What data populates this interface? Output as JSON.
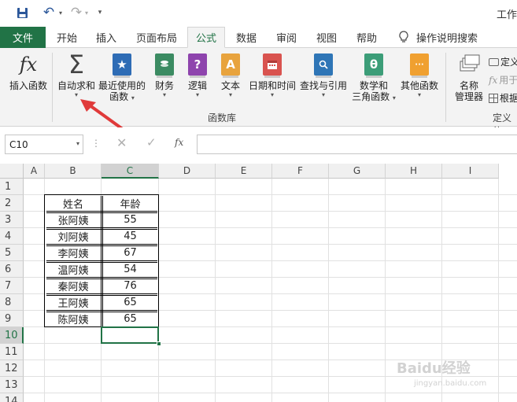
{
  "titlebar": {
    "title": "工作",
    "customize_symbol": "▾",
    "undo_symbol": "↶",
    "redo_symbol": "↷"
  },
  "tabs": [
    {
      "label": "文件"
    },
    {
      "label": "开始"
    },
    {
      "label": "插入"
    },
    {
      "label": "页面布局"
    },
    {
      "label": "公式",
      "active": true
    },
    {
      "label": "数据"
    },
    {
      "label": "审阅"
    },
    {
      "label": "视图"
    },
    {
      "label": "帮助"
    }
  ],
  "tell_me": "操作说明搜索",
  "ribbon": {
    "insert_function": "插入函数",
    "insert_function_symbol": "fx",
    "autosum": "自动求和",
    "autosum_symbol": "Σ",
    "recent_line1": "最近使用的",
    "recent_line2": "函数",
    "financial": "财务",
    "logical": "逻辑",
    "logical_symbol": "?",
    "text": "文本",
    "text_symbol": "A",
    "datetime": "日期和时间",
    "lookup": "查找与引用",
    "math_line1": "数学和",
    "math_line2": "三角函数",
    "math_symbol": "θ",
    "more": "其他函数",
    "more_symbol": "···",
    "group_label": "函数库",
    "name_manager_line1": "名称",
    "name_manager_line2": "管理器",
    "define_name": "定义",
    "use_in_formula": "用于",
    "create_from": "根据",
    "defined_names_group": "定义的",
    "caret": "▾"
  },
  "formula_bar": {
    "name_box": "C10",
    "dots": "⋮",
    "cancel": "✕",
    "enter": "✓",
    "fx": "fx",
    "dropdown": "▾"
  },
  "grid": {
    "columns": [
      "A",
      "B",
      "C",
      "D",
      "E",
      "F",
      "G",
      "H",
      "I"
    ],
    "rows": [
      "1",
      "2",
      "3",
      "4",
      "5",
      "6",
      "7",
      "8",
      "9",
      "10",
      "11",
      "12",
      "13",
      "14"
    ],
    "selected_column": "C",
    "selected_row": "10",
    "table": {
      "headers": [
        "姓名",
        "年龄"
      ],
      "rows": [
        [
          "张阿姨",
          "55"
        ],
        [
          "刘阿姨",
          "45"
        ],
        [
          "李阿姨",
          "67"
        ],
        [
          "温阿姨",
          "54"
        ],
        [
          "秦阿姨",
          "76"
        ],
        [
          "王阿姨",
          "65"
        ],
        [
          "陈阿姨",
          "65"
        ]
      ]
    }
  },
  "watermark": {
    "text": "Baidu经验",
    "url": "jingyan.baidu.com"
  },
  "colors": {
    "excel_green": "#217346",
    "arrow_red": "#e03a3a"
  }
}
